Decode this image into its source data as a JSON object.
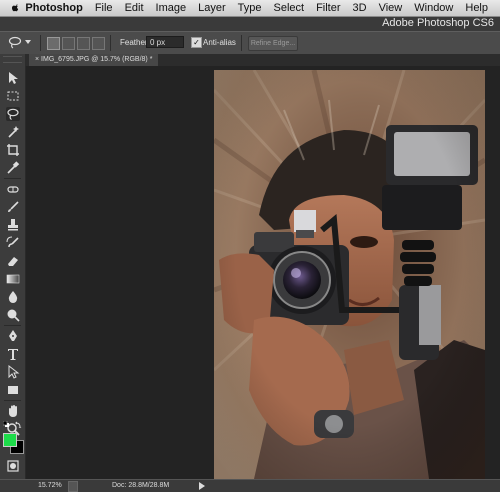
{
  "menubar": {
    "items": [
      "Photoshop",
      "File",
      "Edit",
      "Image",
      "Layer",
      "Type",
      "Select",
      "Filter",
      "3D",
      "View",
      "Window",
      "Help"
    ]
  },
  "titlebar": {
    "title": "Adobe Photoshop CS6"
  },
  "options": {
    "feather_label": "Feather:",
    "feather_value": "0 px",
    "antialias_label": "Anti-alias",
    "antialias_checked": true,
    "refine_edge_label": "Refine Edge..."
  },
  "document_tab": {
    "close": "×",
    "label": "IMG_6795.JPG @ 15.7% (RGB/8) *"
  },
  "colors": {
    "foreground": "#1ddc4a",
    "background": "#000000"
  },
  "status": {
    "zoom": "15.72%",
    "doc_info": "Doc: 28.8M/28.8M"
  }
}
